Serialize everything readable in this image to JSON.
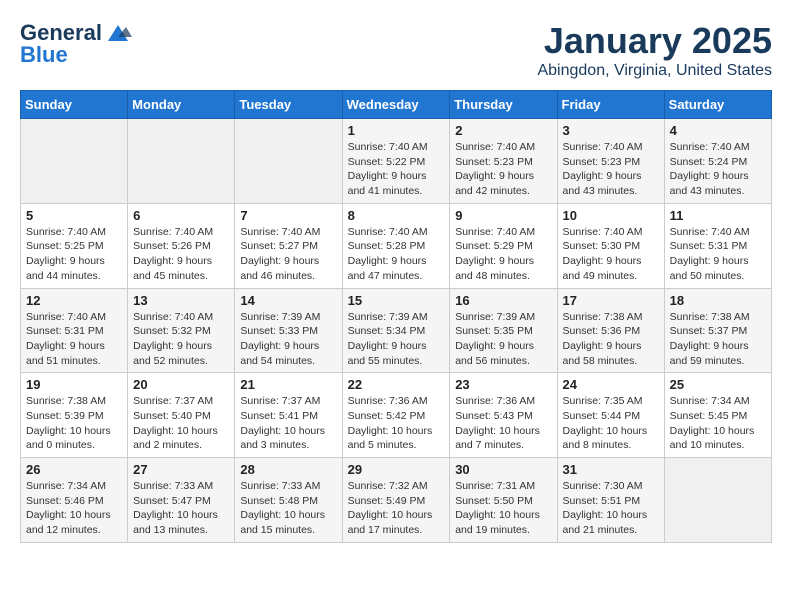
{
  "logo": {
    "line1": "General",
    "line2": "Blue"
  },
  "title": "January 2025",
  "subtitle": "Abingdon, Virginia, United States",
  "days_of_week": [
    "Sunday",
    "Monday",
    "Tuesday",
    "Wednesday",
    "Thursday",
    "Friday",
    "Saturday"
  ],
  "weeks": [
    [
      {
        "day": "",
        "info": ""
      },
      {
        "day": "",
        "info": ""
      },
      {
        "day": "",
        "info": ""
      },
      {
        "day": "1",
        "info": "Sunrise: 7:40 AM\nSunset: 5:22 PM\nDaylight: 9 hours\nand 41 minutes."
      },
      {
        "day": "2",
        "info": "Sunrise: 7:40 AM\nSunset: 5:23 PM\nDaylight: 9 hours\nand 42 minutes."
      },
      {
        "day": "3",
        "info": "Sunrise: 7:40 AM\nSunset: 5:23 PM\nDaylight: 9 hours\nand 43 minutes."
      },
      {
        "day": "4",
        "info": "Sunrise: 7:40 AM\nSunset: 5:24 PM\nDaylight: 9 hours\nand 43 minutes."
      }
    ],
    [
      {
        "day": "5",
        "info": "Sunrise: 7:40 AM\nSunset: 5:25 PM\nDaylight: 9 hours\nand 44 minutes."
      },
      {
        "day": "6",
        "info": "Sunrise: 7:40 AM\nSunset: 5:26 PM\nDaylight: 9 hours\nand 45 minutes."
      },
      {
        "day": "7",
        "info": "Sunrise: 7:40 AM\nSunset: 5:27 PM\nDaylight: 9 hours\nand 46 minutes."
      },
      {
        "day": "8",
        "info": "Sunrise: 7:40 AM\nSunset: 5:28 PM\nDaylight: 9 hours\nand 47 minutes."
      },
      {
        "day": "9",
        "info": "Sunrise: 7:40 AM\nSunset: 5:29 PM\nDaylight: 9 hours\nand 48 minutes."
      },
      {
        "day": "10",
        "info": "Sunrise: 7:40 AM\nSunset: 5:30 PM\nDaylight: 9 hours\nand 49 minutes."
      },
      {
        "day": "11",
        "info": "Sunrise: 7:40 AM\nSunset: 5:31 PM\nDaylight: 9 hours\nand 50 minutes."
      }
    ],
    [
      {
        "day": "12",
        "info": "Sunrise: 7:40 AM\nSunset: 5:31 PM\nDaylight: 9 hours\nand 51 minutes."
      },
      {
        "day": "13",
        "info": "Sunrise: 7:40 AM\nSunset: 5:32 PM\nDaylight: 9 hours\nand 52 minutes."
      },
      {
        "day": "14",
        "info": "Sunrise: 7:39 AM\nSunset: 5:33 PM\nDaylight: 9 hours\nand 54 minutes."
      },
      {
        "day": "15",
        "info": "Sunrise: 7:39 AM\nSunset: 5:34 PM\nDaylight: 9 hours\nand 55 minutes."
      },
      {
        "day": "16",
        "info": "Sunrise: 7:39 AM\nSunset: 5:35 PM\nDaylight: 9 hours\nand 56 minutes."
      },
      {
        "day": "17",
        "info": "Sunrise: 7:38 AM\nSunset: 5:36 PM\nDaylight: 9 hours\nand 58 minutes."
      },
      {
        "day": "18",
        "info": "Sunrise: 7:38 AM\nSunset: 5:37 PM\nDaylight: 9 hours\nand 59 minutes."
      }
    ],
    [
      {
        "day": "19",
        "info": "Sunrise: 7:38 AM\nSunset: 5:39 PM\nDaylight: 10 hours\nand 0 minutes."
      },
      {
        "day": "20",
        "info": "Sunrise: 7:37 AM\nSunset: 5:40 PM\nDaylight: 10 hours\nand 2 minutes."
      },
      {
        "day": "21",
        "info": "Sunrise: 7:37 AM\nSunset: 5:41 PM\nDaylight: 10 hours\nand 3 minutes."
      },
      {
        "day": "22",
        "info": "Sunrise: 7:36 AM\nSunset: 5:42 PM\nDaylight: 10 hours\nand 5 minutes."
      },
      {
        "day": "23",
        "info": "Sunrise: 7:36 AM\nSunset: 5:43 PM\nDaylight: 10 hours\nand 7 minutes."
      },
      {
        "day": "24",
        "info": "Sunrise: 7:35 AM\nSunset: 5:44 PM\nDaylight: 10 hours\nand 8 minutes."
      },
      {
        "day": "25",
        "info": "Sunrise: 7:34 AM\nSunset: 5:45 PM\nDaylight: 10 hours\nand 10 minutes."
      }
    ],
    [
      {
        "day": "26",
        "info": "Sunrise: 7:34 AM\nSunset: 5:46 PM\nDaylight: 10 hours\nand 12 minutes."
      },
      {
        "day": "27",
        "info": "Sunrise: 7:33 AM\nSunset: 5:47 PM\nDaylight: 10 hours\nand 13 minutes."
      },
      {
        "day": "28",
        "info": "Sunrise: 7:33 AM\nSunset: 5:48 PM\nDaylight: 10 hours\nand 15 minutes."
      },
      {
        "day": "29",
        "info": "Sunrise: 7:32 AM\nSunset: 5:49 PM\nDaylight: 10 hours\nand 17 minutes."
      },
      {
        "day": "30",
        "info": "Sunrise: 7:31 AM\nSunset: 5:50 PM\nDaylight: 10 hours\nand 19 minutes."
      },
      {
        "day": "31",
        "info": "Sunrise: 7:30 AM\nSunset: 5:51 PM\nDaylight: 10 hours\nand 21 minutes."
      },
      {
        "day": "",
        "info": ""
      }
    ]
  ]
}
